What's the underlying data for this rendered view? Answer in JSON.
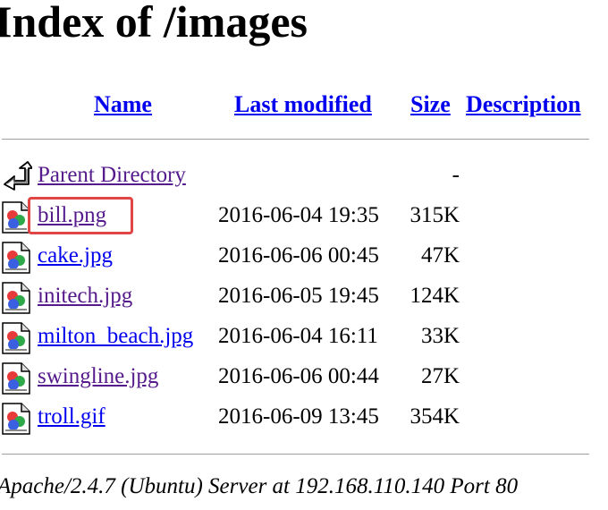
{
  "page": {
    "title": "Index of /images"
  },
  "columns": {
    "name": "Name",
    "last_modified": "Last modified",
    "size": "Size",
    "description": "Description"
  },
  "parent": {
    "label": "Parent Directory",
    "size": "-",
    "icon": "back-icon"
  },
  "files": [
    {
      "name": "bill.png",
      "modified": "2016-06-04 19:35",
      "size": "315K",
      "icon": "image-icon",
      "visited": true,
      "highlighted": true
    },
    {
      "name": "cake.jpg",
      "modified": "2016-06-06 00:45",
      "size": "47K",
      "icon": "image-icon",
      "visited": false
    },
    {
      "name": "initech.jpg",
      "modified": "2016-06-05 19:45",
      "size": "124K",
      "icon": "image-icon",
      "visited": true
    },
    {
      "name": "milton_beach.jpg",
      "modified": "2016-06-04 16:11",
      "size": "33K",
      "icon": "image-icon",
      "visited": false
    },
    {
      "name": "swingline.jpg",
      "modified": "2016-06-06 00:44",
      "size": "27K",
      "icon": "image-icon",
      "visited": true
    },
    {
      "name": "troll.gif",
      "modified": "2016-06-09 13:45",
      "size": "354K",
      "icon": "image-icon",
      "visited": false
    }
  ],
  "footer": {
    "signature": "Apache/2.4.7 (Ubuntu) Server at 192.168.110.140 Port 80"
  },
  "colors": {
    "link": "#0000ee",
    "visited_link": "#551a8b",
    "highlight": "#e04646",
    "rule": "#a0a0a0"
  }
}
